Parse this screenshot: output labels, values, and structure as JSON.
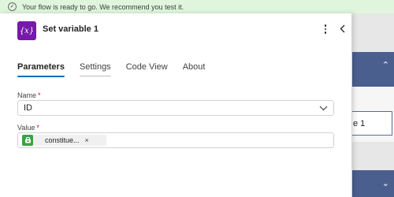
{
  "banner": {
    "message": "Your flow is ready to go. We recommend you test it.",
    "check_glyph": "✓"
  },
  "panel": {
    "icon_text": "{x}",
    "icon_color": "#7719aa",
    "title": "Set variable 1",
    "tabs": [
      {
        "label": "Parameters",
        "active": true
      },
      {
        "label": "Settings",
        "active": false
      },
      {
        "label": "Code View",
        "active": false
      },
      {
        "label": "About",
        "active": false
      }
    ],
    "name_field": {
      "label": "Name",
      "required_marker": "*",
      "value": "ID"
    },
    "value_field": {
      "label": "Value",
      "required_marker": "*",
      "token": {
        "label": "constitue...",
        "icon": "dataverse-icon",
        "icon_color": "#3aa345",
        "remove_glyph": "×"
      }
    }
  },
  "background": {
    "node_label": "e 1",
    "accent_color": "#4b5f8f"
  }
}
